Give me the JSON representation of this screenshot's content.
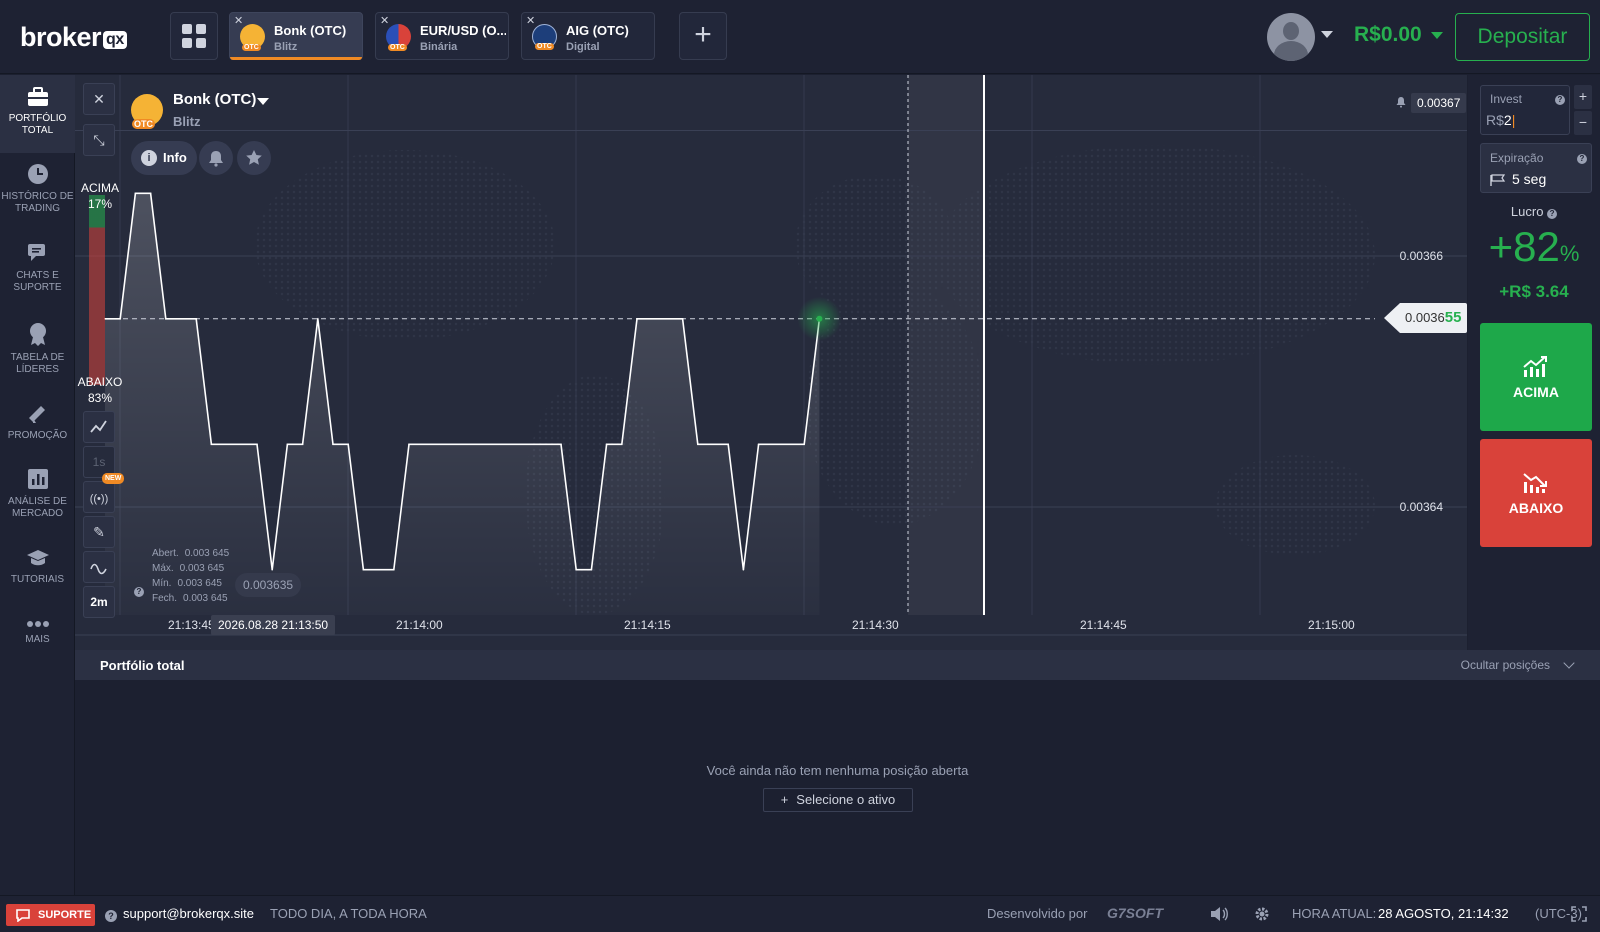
{
  "header": {
    "logo_text": "broker",
    "logo_badge": "qx",
    "tabs": [
      {
        "name": "Bonk (OTC)",
        "type": "Blitz",
        "icon": "bonk-coin-icon",
        "active": true
      },
      {
        "name": "EUR/USD (O...",
        "type": "Binária",
        "icon": "eur-usd-flag-icon",
        "active": false
      },
      {
        "name": "AIG (OTC)",
        "type": "Digital",
        "icon": "aig-logo-icon",
        "active": false
      }
    ],
    "balance": "R$0.00",
    "deposit_label": "Depositar"
  },
  "sidebar": {
    "items": [
      {
        "label": "PORTFÓLIO TOTAL",
        "icon": "briefcase-icon"
      },
      {
        "label": "HISTÓRICO DE TRADING",
        "icon": "clock-icon"
      },
      {
        "label": "CHATS E SUPORTE",
        "icon": "chat-icon"
      },
      {
        "label": "TABELA DE LÍDERES",
        "icon": "trophy-icon"
      },
      {
        "label": "PROMOÇÃO",
        "icon": "megaphone-icon"
      },
      {
        "label": "ANÁLISE DE MERCADO",
        "icon": "analysis-icon"
      },
      {
        "label": "TUTORIAIS",
        "icon": "graduation-cap-icon"
      },
      {
        "label": "MAIS",
        "icon": "more-dots-icon"
      }
    ]
  },
  "asset": {
    "name": "Bonk (OTC)",
    "type": "Blitz",
    "badge": "OTC",
    "info_label": "Info"
  },
  "sentiment": {
    "up_label": "ACIMA",
    "up_pct": "17%",
    "down_label": "ABAIXO",
    "down_pct": "83%"
  },
  "chart_tools": {
    "timeframe": "1s",
    "new_badge": "NEW",
    "period": "2m"
  },
  "ohlc": {
    "open_label": "Abert.",
    "open": "0.003 645",
    "high_label": "Máx.",
    "high": "0.003 645",
    "low_label": "Mín.",
    "low": "0.003 645",
    "close_label": "Fech.",
    "close": "0.003 645"
  },
  "cursor": {
    "price": "0.003635",
    "time": "2026.08.28 21:13:50"
  },
  "price_levels": {
    "top": "0.00367",
    "p366": "0.00366",
    "p364": "0.00364",
    "current_prefix": "0.0036",
    "current_suffix": "55"
  },
  "chart_data": {
    "type": "line",
    "x": [
      "21:13:45",
      "21:13:46",
      "21:13:47",
      "21:13:48",
      "21:13:49",
      "21:13:50",
      "21:13:51",
      "21:13:52",
      "21:13:53",
      "21:13:54",
      "21:13:55",
      "21:13:56",
      "21:13:57",
      "21:13:58",
      "21:13:59",
      "21:14:00",
      "21:14:01",
      "21:14:02",
      "21:14:03",
      "21:14:04",
      "21:14:05",
      "21:14:06",
      "21:14:07",
      "21:14:08",
      "21:14:09",
      "21:14:10",
      "21:14:11",
      "21:14:12",
      "21:14:13",
      "21:14:14",
      "21:14:15",
      "21:14:16",
      "21:14:17",
      "21:14:18",
      "21:14:19",
      "21:14:20",
      "21:14:21",
      "21:14:22",
      "21:14:23",
      "21:14:24",
      "21:14:25",
      "21:14:26",
      "21:14:27",
      "21:14:28",
      "21:14:29",
      "21:14:30",
      "21:14:31",
      "21:14:32"
    ],
    "values": [
      0.003655,
      0.003655,
      0.003665,
      0.003665,
      0.003655,
      0.003655,
      0.003655,
      0.003645,
      0.003645,
      0.003645,
      0.003645,
      0.003635,
      0.003645,
      0.003645,
      0.003655,
      0.003645,
      0.003645,
      0.003635,
      0.003635,
      0.003635,
      0.003645,
      0.003645,
      0.003645,
      0.003645,
      0.003645,
      0.003645,
      0.003645,
      0.003645,
      0.003645,
      0.003645,
      0.003645,
      0.003635,
      0.003635,
      0.003645,
      0.003645,
      0.003655,
      0.003655,
      0.003655,
      0.003655,
      0.003645,
      0.003645,
      0.003645,
      0.003635,
      0.003645,
      0.003645,
      0.003645,
      0.003645,
      0.003655
    ],
    "x_ticks": [
      "21:13:45",
      "21:14:00",
      "21:14:15",
      "21:14:30",
      "21:14:45",
      "21:15:00"
    ],
    "y_ticks": [
      "0.00367",
      "0.00366",
      "0.00364"
    ],
    "ylim": [
      0.00363,
      0.003672
    ],
    "grid": true,
    "line_color": "#ffffff",
    "current_value": 0.003655,
    "expiry_time": "21:14:37"
  },
  "panel": {
    "invest_label": "Invest",
    "currency": "R$",
    "invest_value": "2",
    "plus": "+",
    "minus": "−",
    "expiry_label": "Expiração",
    "expiry_value": "5 seg",
    "profit_label": "Lucro",
    "profit_pct": "+82",
    "pct_sign": "%",
    "profit_amount": "+R$ 3.64",
    "up_label": "ACIMA",
    "down_label": "ABAIXO"
  },
  "portfolio": {
    "title": "Portfólio total",
    "hide_label": "Ocultar posições",
    "empty_text": "Você ainda não tem nenhuma posição aberta",
    "select_label": "Selecione o ativo"
  },
  "footer": {
    "support_label": "SUPORTE",
    "email": "support@brokerqx.site",
    "schedule": "TODO DIA, A TODA HORA",
    "developed_by": "Desenvolvido por",
    "dev_brand": "G7SOFT",
    "time_label": "HORA ATUAL:",
    "time_value": "28 AGOSTO, 21:14:32",
    "timezone": "(UTC-3)"
  },
  "colors": {
    "accent_green": "#27b04f",
    "accent_red": "#d9423a",
    "accent_orange": "#f08a24",
    "bg": "#1c2030"
  }
}
